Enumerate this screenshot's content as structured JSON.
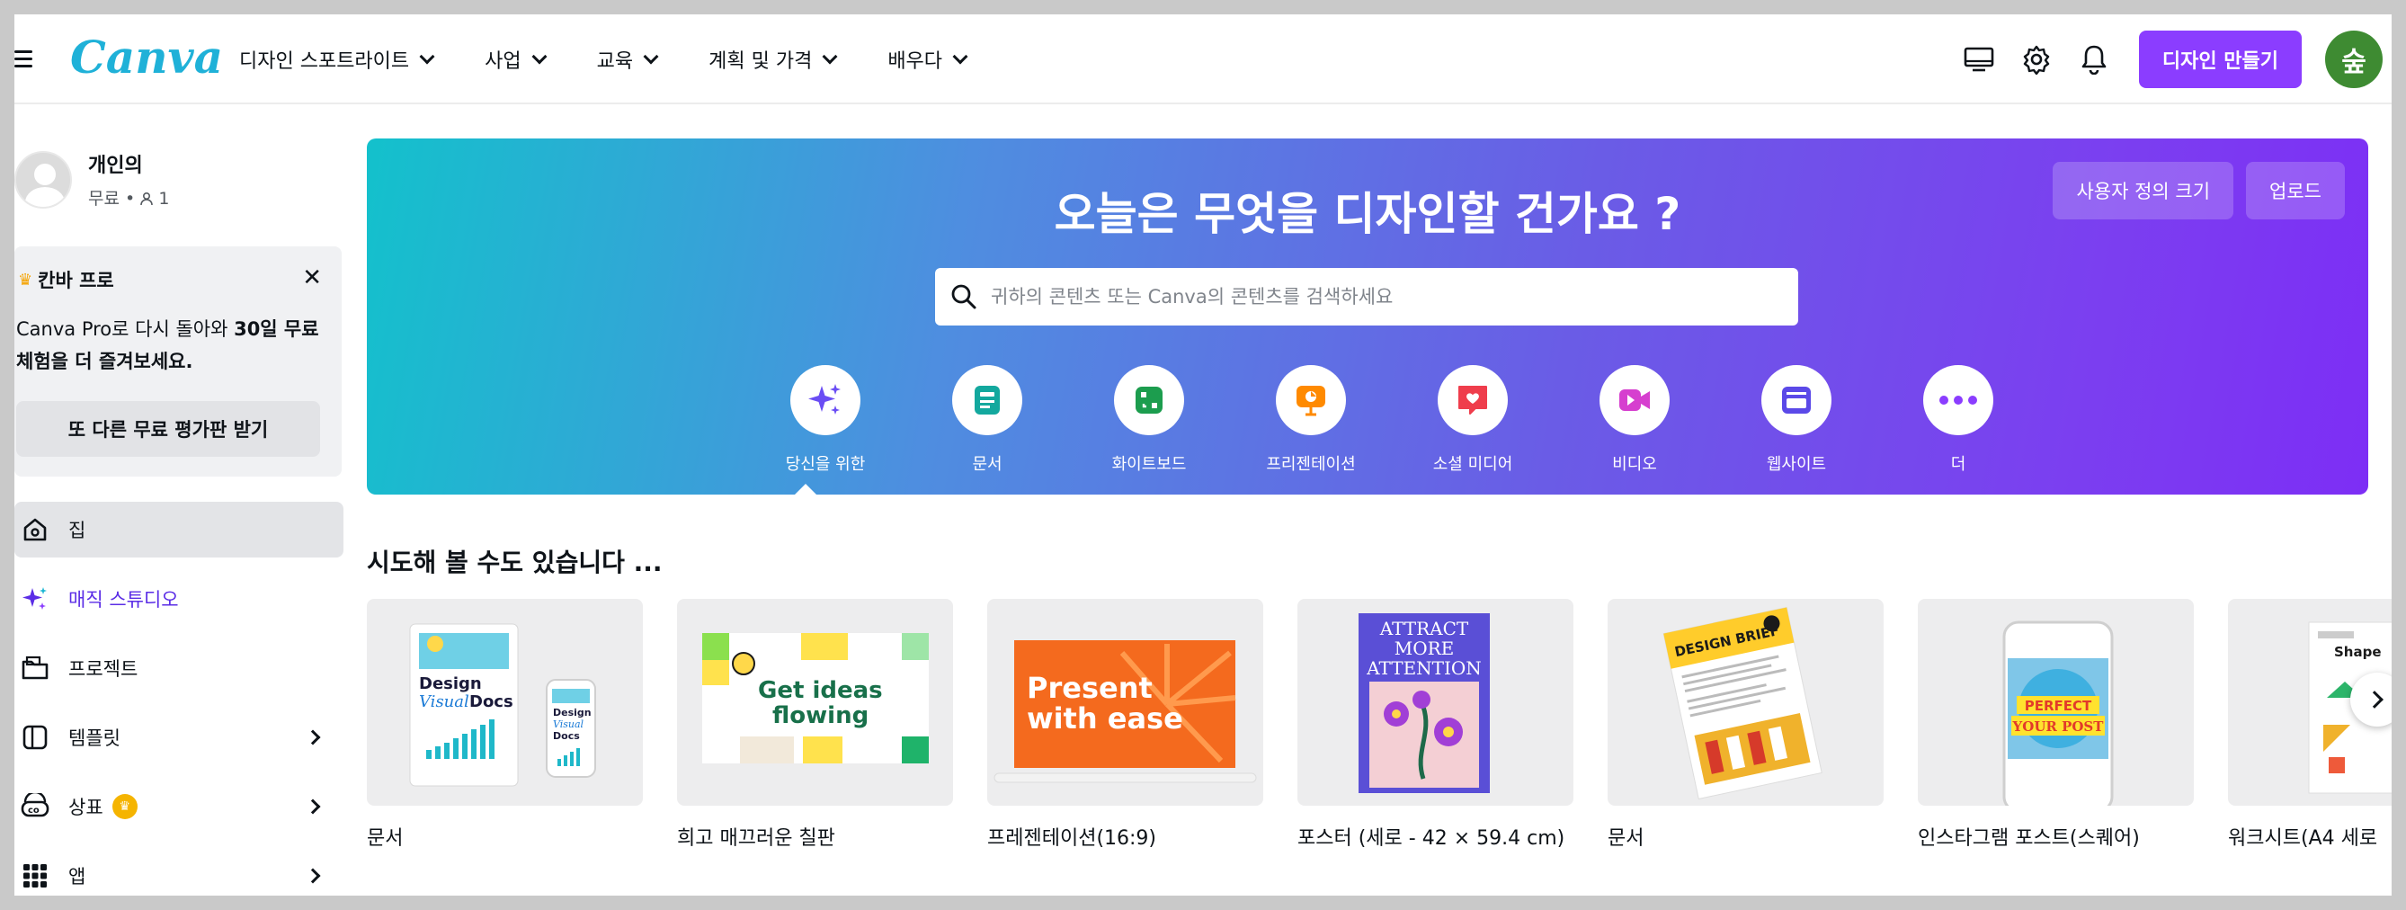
{
  "header": {
    "logo": "Canva",
    "nav": [
      {
        "label": "디자인 스포트라이트"
      },
      {
        "label": "사업"
      },
      {
        "label": "교육"
      },
      {
        "label": "계획 및 가격"
      },
      {
        "label": "배우다"
      }
    ],
    "create_label": "디자인 만들기",
    "avatar_initial": "숲"
  },
  "sidebar": {
    "profile": {
      "name": "개인의",
      "plan": "무료",
      "members": "1"
    },
    "promo": {
      "title": "칸바 프로",
      "body_part1": "Canva Pro로 다시 돌아와 ",
      "body_bold1": "30일 무료",
      "body_bold2": "체험을 더 즐겨보세요.",
      "button": "또 다른 무료 평가판 받기"
    },
    "items": [
      {
        "label": "집"
      },
      {
        "label": "매직 스튜디오"
      },
      {
        "label": "프로젝트"
      },
      {
        "label": "템플릿"
      },
      {
        "label": "상표"
      },
      {
        "label": "앱"
      }
    ]
  },
  "hero": {
    "title": "오늘은 무엇을 디자인할 건가요 ?",
    "custom_size": "사용자 정의 크기",
    "upload": "업로드",
    "search_placeholder": "귀하의 콘텐츠 또는 Canva의 콘텐츠를 검색하세요",
    "categories": [
      {
        "label": "당신을 위한",
        "icon": "sparkle-icon",
        "color": "#6a4df4"
      },
      {
        "label": "문서",
        "icon": "document-icon",
        "color": "#13a89e"
      },
      {
        "label": "화이트보드",
        "icon": "whiteboard-icon",
        "color": "#1c9d4e"
      },
      {
        "label": "프리젠테이션",
        "icon": "presentation-icon",
        "color": "#ff8a00"
      },
      {
        "label": "소셜 미디어",
        "icon": "heart-icon",
        "color": "#ef3d4c"
      },
      {
        "label": "비디오",
        "icon": "video-icon",
        "color": "#d63fcf"
      },
      {
        "label": "웹사이트",
        "icon": "website-icon",
        "color": "#5b49e8"
      },
      {
        "label": "더",
        "icon": "more-icon",
        "color": "#8b3dff"
      }
    ]
  },
  "suggestions": {
    "title": "시도해 볼 수도 있습니다 ...",
    "cards": [
      {
        "label": "문서",
        "thumb_text": "Design Visual Docs"
      },
      {
        "label": "희고 매끄러운 칠판",
        "thumb_text": "Get ideas flowing"
      },
      {
        "label": "프레젠테이션(16:9)",
        "thumb_text": "Present with ease"
      },
      {
        "label": "포스터 (세로 - 42 × 59.4 cm)",
        "thumb_text": "ATTRACT MORE ATTENTION"
      },
      {
        "label": "문서",
        "thumb_text": "DESIGN BRIEF"
      },
      {
        "label": "인스타그램 포스트(스퀘어)",
        "thumb_text": "PERFECT YOUR POST"
      },
      {
        "label": "워크시트(A4 세로",
        "thumb_text": "Shape"
      }
    ]
  },
  "colors": {
    "brand": "#8b3dff",
    "logo": "#1fb1d8",
    "avatar": "#3e8b32"
  }
}
